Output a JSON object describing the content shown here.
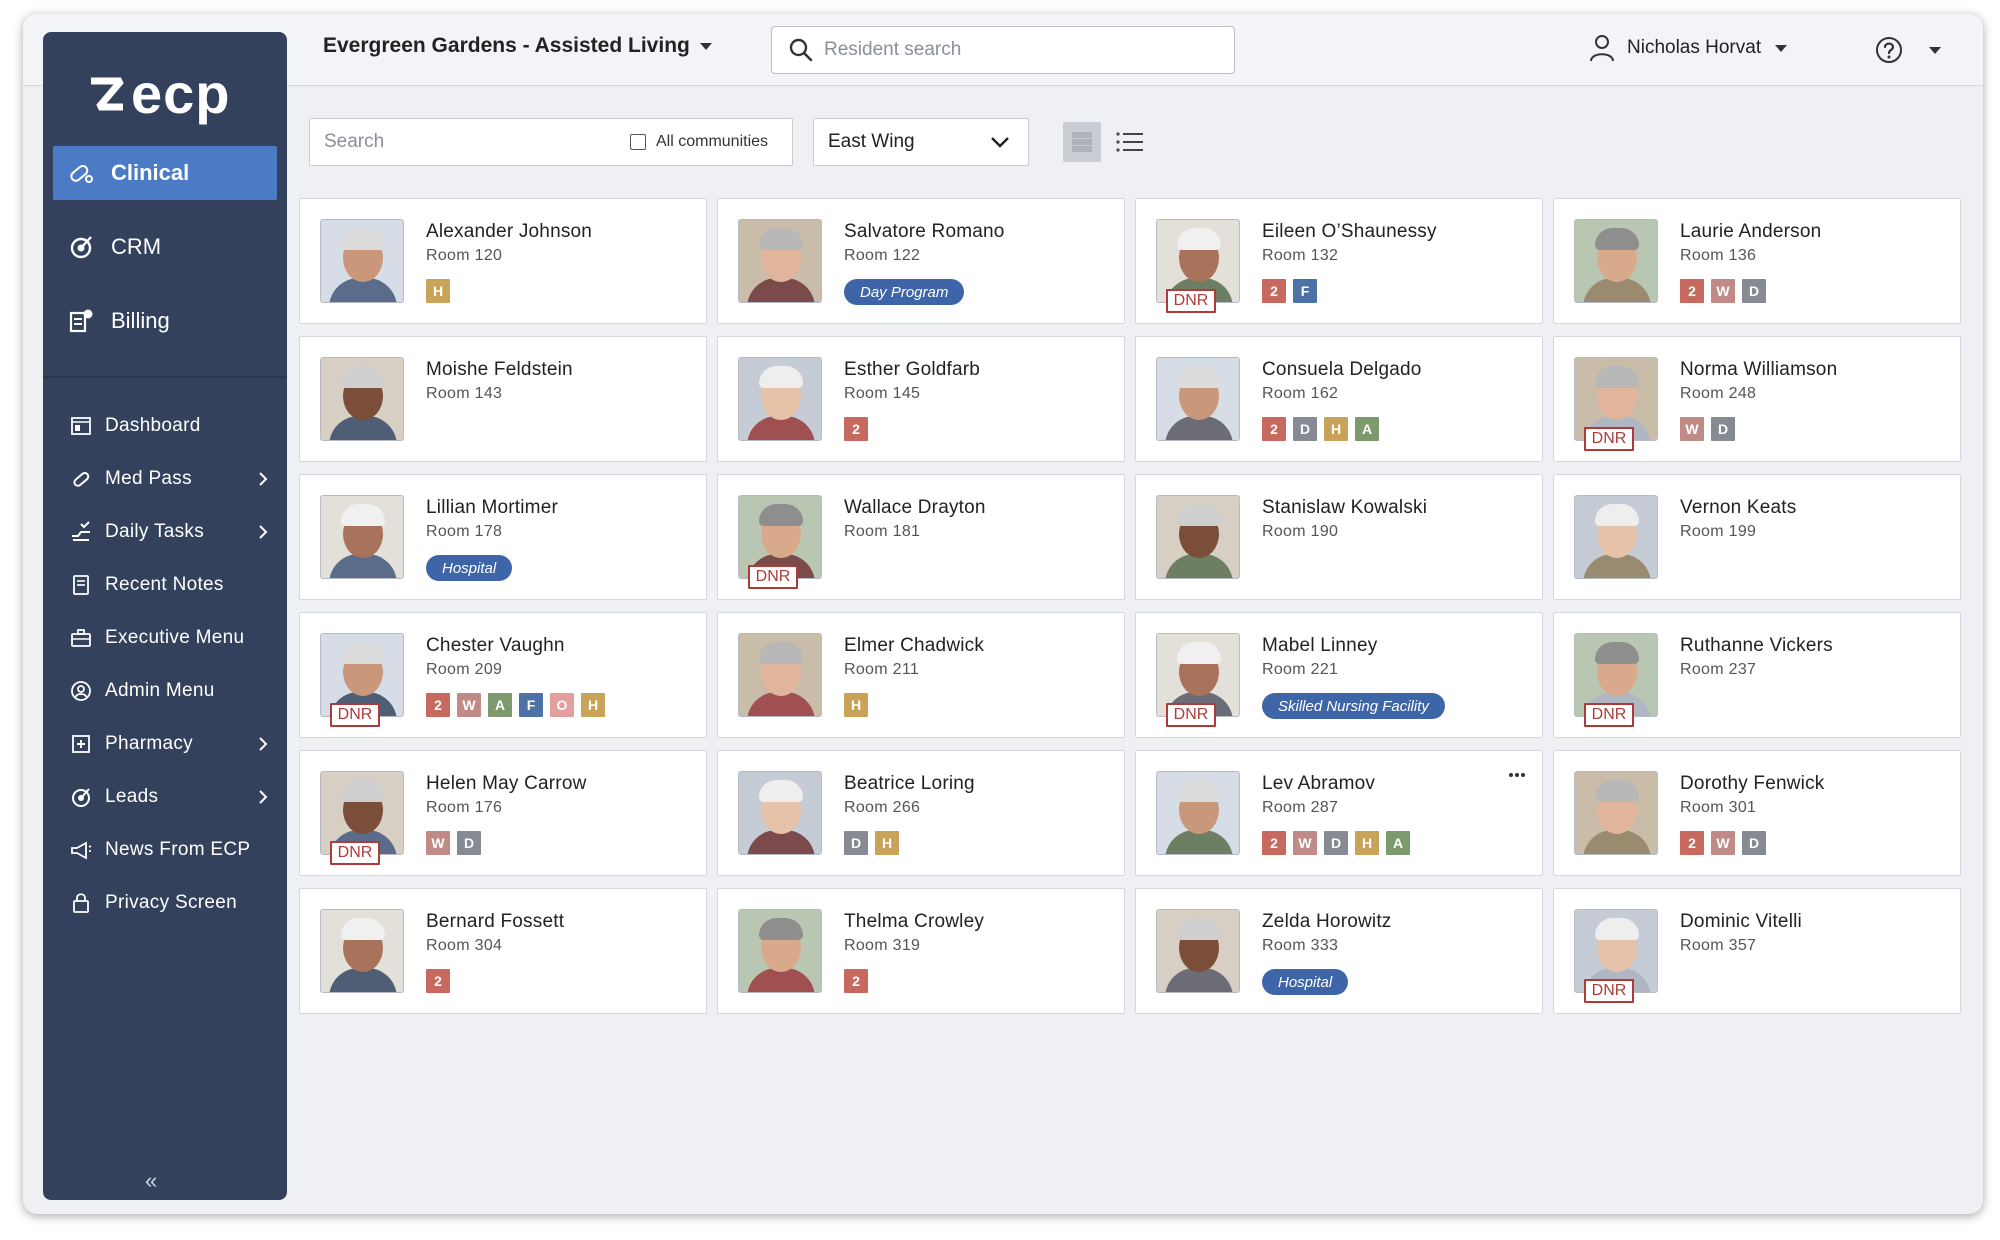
{
  "brand": {
    "logo_text": "ecp"
  },
  "header": {
    "community": "Evergreen Gardens - Assisted Living",
    "search_placeholder": "Resident search",
    "user_name": "Nicholas Horvat"
  },
  "sidebar": {
    "top_items": [
      {
        "label": "Clinical",
        "icon": "clinical-icon",
        "active": true
      },
      {
        "label": "CRM",
        "icon": "crm-icon"
      },
      {
        "label": "Billing",
        "icon": "billing-icon"
      }
    ],
    "items": [
      {
        "label": "Dashboard",
        "icon": "dashboard-icon"
      },
      {
        "label": "Med Pass",
        "icon": "med-pass-icon",
        "submenu": true
      },
      {
        "label": "Daily Tasks",
        "icon": "daily-tasks-icon",
        "submenu": true
      },
      {
        "label": "Recent Notes",
        "icon": "notes-icon"
      },
      {
        "label": "Executive Menu",
        "icon": "briefcase-icon"
      },
      {
        "label": "Admin Menu",
        "icon": "admin-icon"
      },
      {
        "label": "Pharmacy",
        "icon": "pharmacy-icon",
        "submenu": true
      },
      {
        "label": "Leads",
        "icon": "leads-icon",
        "submenu": true
      },
      {
        "label": "News From ECP",
        "icon": "megaphone-icon"
      },
      {
        "label": "Privacy Screen",
        "icon": "lock-icon"
      }
    ],
    "collapse_label": "«"
  },
  "filters": {
    "search_placeholder": "Search",
    "all_communities_label": "All communities",
    "wing_value": "East Wing"
  },
  "badge_colors": {
    "2": "#c8695f",
    "H": "#c9a35a",
    "F": "#4e72a6",
    "W": "#c08a86",
    "D": "#868b93",
    "A": "#7c9a6e",
    "O": "#e39e9e"
  },
  "residents": [
    {
      "name": "Alexander Johnson",
      "room": "Room 120",
      "badges": [
        "H"
      ],
      "dnr": false
    },
    {
      "name": "Salvatore Romano",
      "room": "Room 122",
      "pill": "Day Program",
      "dnr": false
    },
    {
      "name": "Eileen O’Shaunessy",
      "room": "Room 132",
      "badges": [
        "2",
        "F"
      ],
      "dnr": true
    },
    {
      "name": "Laurie Anderson",
      "room": "Room 136",
      "badges": [
        "2",
        "W",
        "D"
      ],
      "dnr": false
    },
    {
      "name": "Moishe Feldstein",
      "room": "Room 143",
      "dnr": false
    },
    {
      "name": "Esther Goldfarb",
      "room": "Room 145",
      "badges": [
        "2"
      ],
      "dnr": false
    },
    {
      "name": "Consuela Delgado",
      "room": "Room 162",
      "badges": [
        "2",
        "D",
        "H",
        "A"
      ],
      "dnr": false
    },
    {
      "name": "Norma Williamson",
      "room": "Room 248",
      "badges": [
        "W",
        "D"
      ],
      "dnr": true
    },
    {
      "name": "Lillian Mortimer",
      "room": "Room 178",
      "pill": "Hospital",
      "dnr": false
    },
    {
      "name": "Wallace Drayton",
      "room": "Room 181",
      "dnr": true
    },
    {
      "name": "Stanislaw Kowalski",
      "room": "Room 190",
      "dnr": false
    },
    {
      "name": "Vernon Keats",
      "room": "Room 199",
      "dnr": false
    },
    {
      "name": "Chester Vaughn",
      "room": "Room 209",
      "badges": [
        "2",
        "W",
        "A",
        "F",
        "O",
        "H"
      ],
      "dnr": true
    },
    {
      "name": "Elmer Chadwick",
      "room": "Room 211",
      "badges": [
        "H"
      ],
      "dnr": false
    },
    {
      "name": "Mabel Linney",
      "room": "Room 221",
      "pill": "Skilled Nursing Facility",
      "dnr": true
    },
    {
      "name": "Ruthanne Vickers",
      "room": "Room 237",
      "dnr": true
    },
    {
      "name": "Helen May Carrow",
      "room": "Room 176",
      "badges": [
        "W",
        "D"
      ],
      "dnr": true
    },
    {
      "name": "Beatrice Loring",
      "room": "Room 266",
      "badges": [
        "D",
        "H"
      ],
      "dnr": false
    },
    {
      "name": "Lev Abramov",
      "room": "Room 287",
      "badges": [
        "2",
        "W",
        "D",
        "H",
        "A"
      ],
      "dnr": false,
      "more": true
    },
    {
      "name": "Dorothy Fenwick",
      "room": "Room 301",
      "badges": [
        "2",
        "W",
        "D"
      ],
      "dnr": false
    },
    {
      "name": "Bernard Fossett",
      "room": "Room 304",
      "badges": [
        "2"
      ],
      "dnr": false
    },
    {
      "name": "Thelma Crowley",
      "room": "Room 319",
      "badges": [
        "2"
      ],
      "dnr": false
    },
    {
      "name": "Zelda Horowitz",
      "room": "Room 333",
      "pill": "Hospital",
      "dnr": false
    },
    {
      "name": "Dominic Vitelli",
      "room": "Room 357",
      "dnr": true
    }
  ],
  "dnr_label": "DNR"
}
